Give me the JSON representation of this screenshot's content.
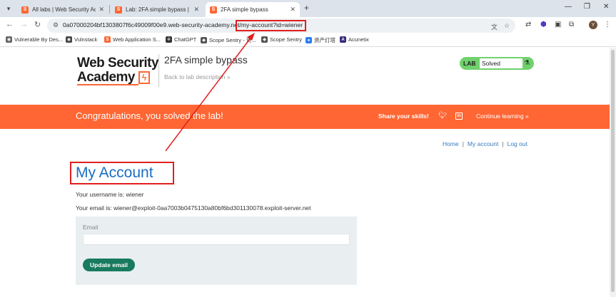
{
  "browser": {
    "tabs": [
      {
        "title": "All labs | Web Security Acade",
        "active": false
      },
      {
        "title": "Lab: 2FA simple bypass | Web",
        "active": false
      },
      {
        "title": "2FA simple bypass",
        "active": true
      }
    ],
    "url": "0a07000204bf1303807f6c49009f00e9.web-security-academy.net/my-account?id=wiener",
    "bookmarks": [
      "Vulnerable By Des...",
      "Vulnstack",
      "Web Application S...",
      "ChatGPT",
      "Scope Sentry - 资...",
      "Scope Sentry",
      "资产灯塔",
      "Acunetix"
    ],
    "profile_initial": "Y"
  },
  "header": {
    "logo_line1": "Web Security",
    "logo_line2": "Academy",
    "lab_title": "2FA simple bypass",
    "back_link": "Back to lab description",
    "badge_label": "LAB",
    "badge_status": "Solved"
  },
  "banner": {
    "message": "Congratulations, you solved the lab!",
    "share": "Share your skills!",
    "continue": "Continue learning"
  },
  "nav": {
    "home": "Home",
    "my_account": "My account",
    "log_out": "Log out"
  },
  "account": {
    "title": "My Account",
    "username_line": "Your username is: wiener",
    "email_line": "Your email is: wiener@exploit-0aa7003b0475130a80bf6bd301130078.exploit-server.net",
    "email_label": "Email",
    "email_value": "",
    "update_button": "Update email"
  },
  "colors": {
    "brand_orange": "#ff6633",
    "solved_green": "#70d16d",
    "button_green": "#187a5e",
    "link_blue": "#3a7bbf",
    "annotation_red": "#e0201f"
  }
}
